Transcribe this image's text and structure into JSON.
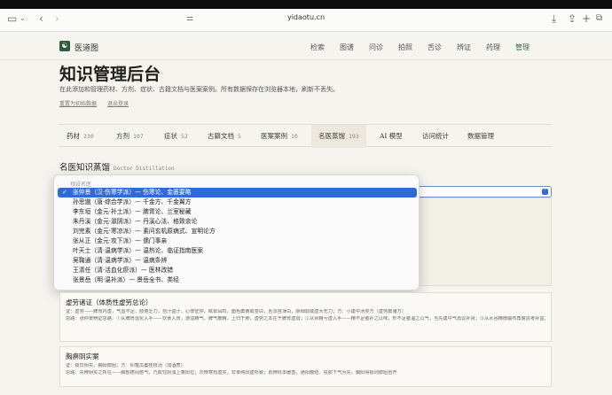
{
  "browser": {
    "url": "yidaotu.cn",
    "icons": [
      "sidebar-icon",
      "back-icon",
      "forward-icon",
      "page-settings-icon",
      "download-icon",
      "share-icon",
      "new-tab-icon",
      "tabs-icon"
    ]
  },
  "nav": {
    "brand": "医道图",
    "logo_glyph": "☯",
    "links": [
      "检索",
      "图谱",
      "问诊",
      "拍照",
      "舌诊",
      "辨证",
      "药理",
      "管理"
    ],
    "active": "管理"
  },
  "page": {
    "title": "知识管理后台",
    "subtitle": "在此添加和管理药材、方剂、症状、古籍文档与医案案例。所有数据保存在浏览器本地，刷新不丢失。",
    "link_reset": "重置为初始数据",
    "link_logout": "退出登录"
  },
  "tabs": [
    {
      "label": "药材",
      "count": "230"
    },
    {
      "label": "方剂",
      "count": "107"
    },
    {
      "label": "症状",
      "count": "52"
    },
    {
      "label": "古籍文档",
      "count": "5"
    },
    {
      "label": "医案案例",
      "count": "10"
    },
    {
      "label": "名医蒸馏",
      "count": "193"
    },
    {
      "label": "AI 模型",
      "count": ""
    },
    {
      "label": "访问统计",
      "count": ""
    },
    {
      "label": "数据管理",
      "count": ""
    }
  ],
  "active_tab": "名医蒸馏",
  "section": {
    "title": "名医知识蒸馏",
    "title_en": "Doctor Distillation"
  },
  "dropdown": {
    "group_label": "预设名医",
    "options": [
      "张仲景（汉·伤寒学派）— 伤寒论、金匮要略",
      "孙思邈（唐·综合学派）— 千金方、千金翼方",
      "李东垣（金元·补土派）— 脾胃论、兰室秘藏",
      "朱丹溪（金元·滋阴派）— 丹溪心法、格致余论",
      "刘完素（金元·寒凉派）— 素问玄机原病式、宣明论方",
      "张从正（金元·攻下派）— 儒门事亲",
      "叶天士（清·温病学派）— 温热论、临证指南医案",
      "吴鞠通（清·温病学派）— 温病条辨",
      "王清任（清·活血化瘀派）— 医林改错",
      "张景岳（明·温补派）— 景岳全书、类经"
    ],
    "selected_index": 0
  },
  "cards": [
    {
      "title": "虚劳诸证（体质性虚劳总论）",
      "lines": [
        "证：虚劳——脾胃内虚，气血不足，肢倦乏力，自汗盗汗，心悸怔忡，眩晕耳鸣，面色萎黄或苍白，舌淡苔薄白，脉细弱或虚大无力；方：小建中汤类方（虚劳篇诸方）",
        "思路：张仲景辨证思路：①从脾胃运化入手——饮食入胃，游溢精气，脾气散精，上归于肺，虚劳之本在于脾胃虚弱；②从肾精亏虚入手——精不足者补之以味，形不足者温之以气，当先建中气再议补肾；③从水谷精微输布角度思考补益之法，气血生化有源则虚劳自复"
      ]
    },
    {
      "title": "胸痹阴实案",
      "lines": [
        "证：痰饮阴实，胸阳痹阻；方：枳薤瓜蒌桂枝汤（加酒煮）",
        "思路：先辨阴实之所在——胸部痞闷憋气，乃痰饮阴浊上乘阳位；次辨寒热虚实，非单纯阳虚所致；再辨标本缓急，通阳散结、祛痰下气为先，胸阳得振则痹阻自开"
      ]
    }
  ],
  "colors": {
    "accent": "#3a6a48",
    "select_blue": "#2f6bd8",
    "background": "#f6f4ee"
  }
}
